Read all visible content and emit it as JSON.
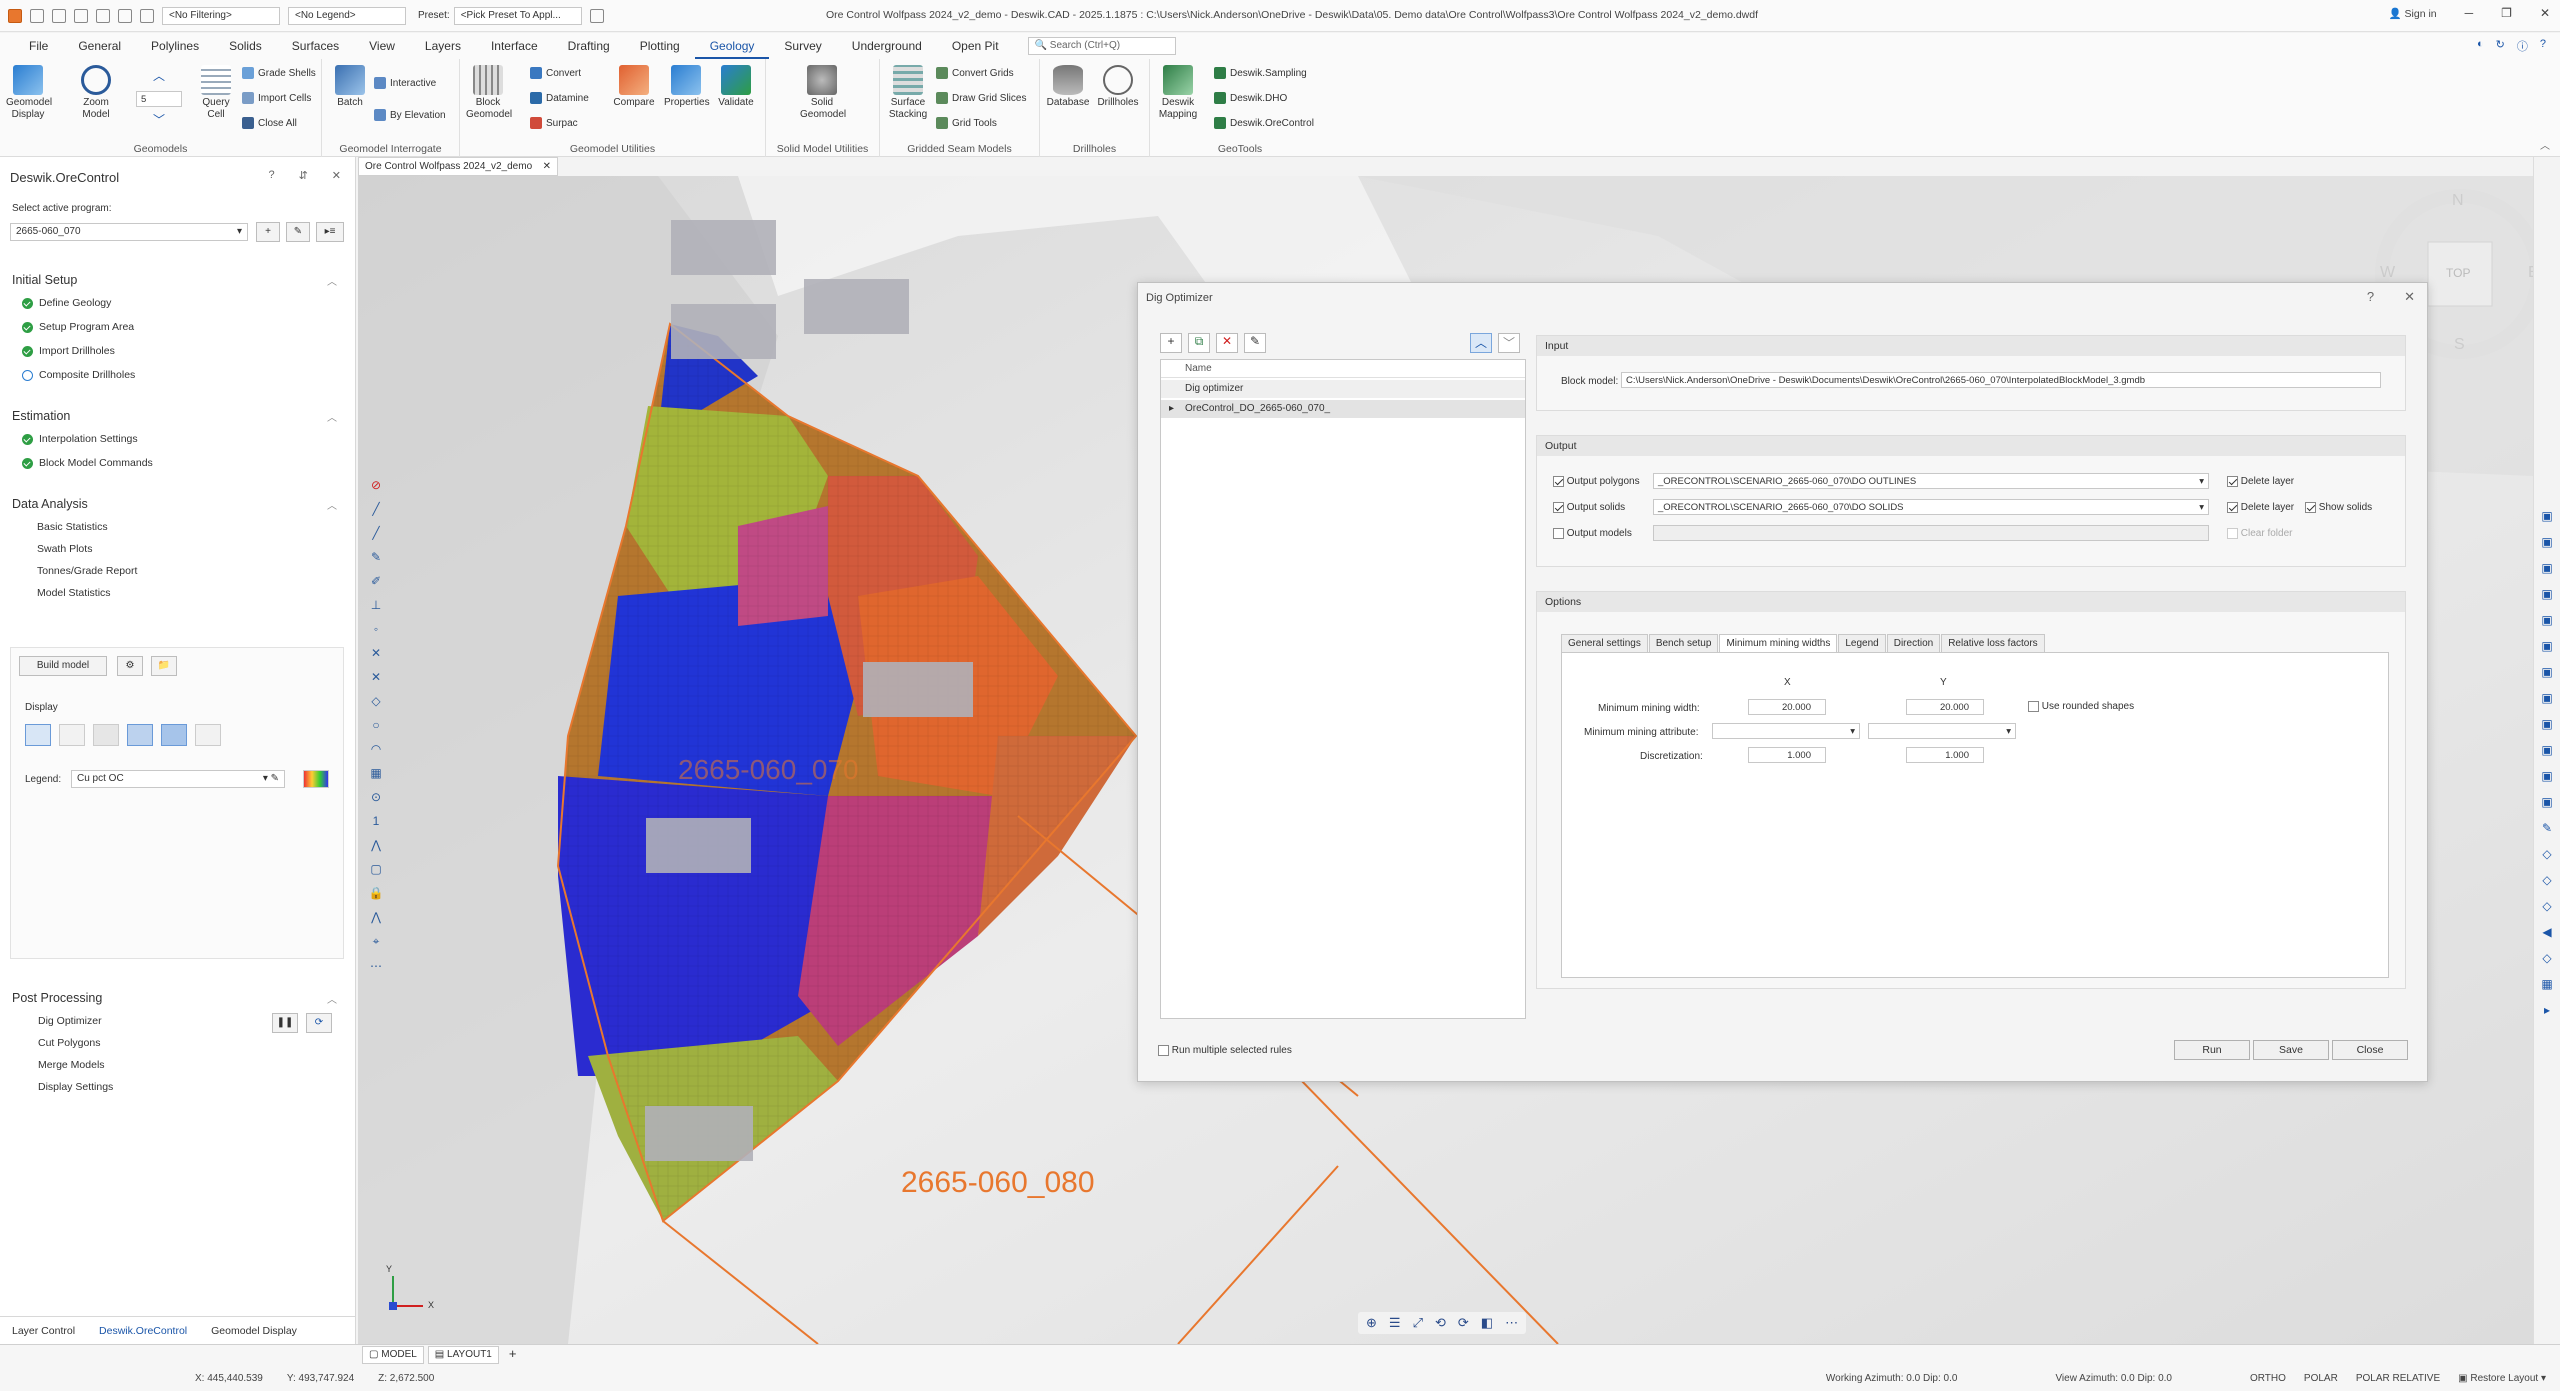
{
  "title": {
    "filter": "<No Filtering>",
    "legend": "<No Legend>",
    "preset_label": "Preset:",
    "preset": "<Pick Preset To Appl...",
    "window_title": "Ore Control Wolfpass 2024_v2_demo - Deswik.CAD - 2025.1.1875 : C:\\Users\\Nick.Anderson\\OneDrive - Deswik\\Data\\05. Demo data\\Ore Control\\Wolfpass3\\Ore Control Wolfpass 2024_v2_demo.dwdf",
    "sign_in": "Sign in"
  },
  "menu": [
    "File",
    "General",
    "Polylines",
    "Solids",
    "Surfaces",
    "View",
    "Layers",
    "Interface",
    "Drafting",
    "Plotting",
    "Geology",
    "Survey",
    "Underground",
    "Open Pit"
  ],
  "search_placeholder": "Search (Ctrl+Q)",
  "ribbon": {
    "geomodels": {
      "label": "Geomodels",
      "geomodel_display": "Geomodel Display",
      "zoom_model": "Zoom Model",
      "query_cell": "Query Cell",
      "grade_shells": "Grade Shells",
      "import_cells": "Import Cells",
      "close_all": "Close All",
      "spin_value": "5"
    },
    "interrogate": {
      "label": "Geomodel Interrogate",
      "batch": "Batch",
      "interactive": "Interactive",
      "by_elevation": "By Elevation"
    },
    "utilities": {
      "label": "Geomodel Utilities",
      "block_geomodel": "Block Geomodel",
      "convert": "Convert",
      "datamine": "Datamine",
      "surpac": "Surpac",
      "compare": "Compare",
      "properties": "Properties",
      "validate": "Validate"
    },
    "solid_utils": {
      "label": "Solid Model Utilities",
      "solid_geomodel": "Solid Geomodel"
    },
    "gridded": {
      "label": "Gridded Seam Models",
      "surface_stacking": "Surface Stacking",
      "convert_grids": "Convert Grids",
      "draw_grid_slices": "Draw Grid Slices",
      "grid_tools": "Grid Tools"
    },
    "drillholes": {
      "label": "Drillholes",
      "database": "Database",
      "drillholes": "Drillholes"
    },
    "geotools": {
      "label": "GeoTools",
      "deswik_mapping": "Deswik Mapping",
      "sampling": "Deswik.Sampling",
      "dho": "Deswik.DHO",
      "orecontrol": "Deswik.OreControl"
    }
  },
  "left": {
    "title": "Deswik.OreControl",
    "select_label": "Select active program:",
    "program": "2665-060_070",
    "sections": {
      "initial": {
        "title": "Initial Setup",
        "items": [
          "Define Geology",
          "Setup Program Area",
          "Import Drillholes",
          "Composite Drillholes"
        ]
      },
      "estimation": {
        "title": "Estimation",
        "items": [
          "Interpolation Settings",
          "Block Model Commands"
        ]
      },
      "analysis": {
        "title": "Data Analysis",
        "items": [
          "Basic Statistics",
          "Swath Plots",
          "Tonnes/Grade Report",
          "Model Statistics"
        ]
      },
      "post": {
        "title": "Post Processing",
        "items": [
          "Dig Optimizer",
          "Cut Polygons",
          "Merge Models",
          "Display Settings"
        ]
      }
    },
    "build_model": "Build model",
    "display_label": "Display",
    "legend_label": "Legend:",
    "legend_value": "Cu pct OC",
    "tabs": [
      "Layer Control",
      "Deswik.OreControl",
      "Geomodel Display"
    ]
  },
  "doc_tab": "Ore Control Wolfpass 2024_v2_demo",
  "viewport": {
    "labels": [
      "2665-060_070",
      "2665-060_080"
    ],
    "compass": {
      "n": "N",
      "e": "E",
      "s": "S",
      "w": "W",
      "top": "TOP"
    },
    "axis": {
      "x": "X",
      "y": "Y"
    }
  },
  "dialog": {
    "title": "Dig Optimizer",
    "help": "?",
    "close_x": "✕",
    "list": {
      "header": "Name",
      "root": "Dig optimizer",
      "child": "OreControl_DO_2665-060_070_"
    },
    "input": {
      "header": "Input",
      "block_model_label": "Block model:",
      "block_model": "C:\\Users\\Nick.Anderson\\OneDrive - Deswik\\Documents\\Deswik\\OreControl\\2665-060_070\\InterpolatedBlockModel_3.gmdb"
    },
    "output": {
      "header": "Output",
      "polygons_label": "Output polygons",
      "polygons": "_ORECONTROL\\SCENARIO_2665-060_070\\DO OUTLINES",
      "solids_label": "Output solids",
      "solids": "_ORECONTROL\\SCENARIO_2665-060_070\\DO SOLIDS",
      "models_label": "Output models",
      "delete_layer": "Delete layer",
      "show_solids": "Show solids",
      "clear_folder": "Clear folder"
    },
    "options": {
      "header": "Options",
      "tabs": [
        "General settings",
        "Bench setup",
        "Minimum mining widths",
        "Legend",
        "Direction",
        "Relative loss factors"
      ],
      "col_x": "X",
      "col_y": "Y",
      "min_width_label": "Minimum mining width:",
      "min_width_x": "20.000",
      "min_width_y": "20.000",
      "rounded": "Use rounded shapes",
      "attr_label": "Minimum mining attribute:",
      "disc_label": "Discretization:",
      "disc_x": "1.000",
      "disc_y": "1.000"
    },
    "run_multiple": "Run multiple selected rules",
    "buttons": {
      "run": "Run",
      "save": "Save",
      "close": "Close"
    }
  },
  "status": {
    "model_tab": "MODEL",
    "layout_tab": "LAYOUT1",
    "x": "X: 445,440.539",
    "y": "Y: 493,747.924",
    "z": "Z: 2,672.500",
    "working": "Working Azimuth: 0.0 Dip: 0.0",
    "view": "View Azimuth: 0.0 Dip: 0.0",
    "ortho": "ORTHO",
    "polar": "POLAR",
    "polar_rel": "POLAR RELATIVE",
    "restore": "Restore Layout"
  },
  "colors": {
    "accent": "#1a55a8",
    "orange": "#e8772e",
    "check": "#2e9e44"
  }
}
